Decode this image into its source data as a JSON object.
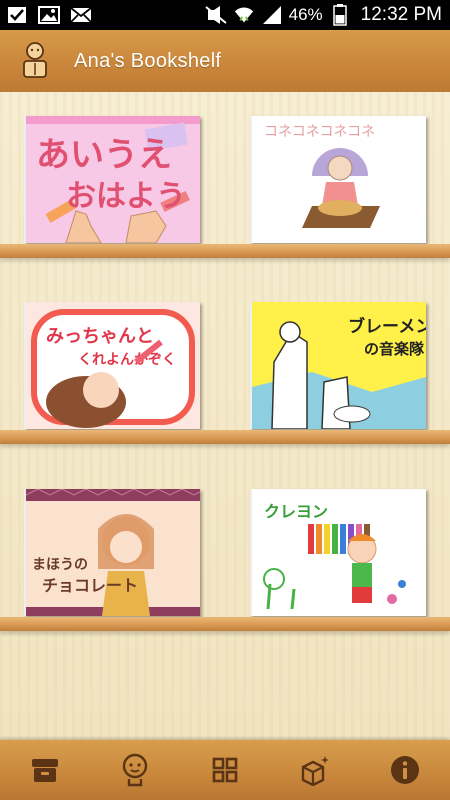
{
  "status_bar": {
    "battery_percent": "46%",
    "time": "12:32 PM",
    "icons": [
      "checkbox-icon",
      "image-icon",
      "mail-icon",
      "mute-icon",
      "wifi-icon",
      "signal-icon",
      "battery-icon"
    ]
  },
  "header": {
    "title": "Ana's Bookshelf",
    "logo_icon": "reading-character-icon"
  },
  "books": [
    {
      "title": "あいうえおはよう",
      "cover_color": "#f7c9e6"
    },
    {
      "title": "コネコネコネコネ",
      "cover_color": "#ffffff"
    },
    {
      "title": "みっちゃんとくれよんかぞく",
      "cover_color": "#fde7e0"
    },
    {
      "title": "ブレーメンの音楽隊",
      "cover_color": "#fff04a"
    },
    {
      "title": "まほうのチョコレート",
      "cover_color": "#fbe2cf"
    },
    {
      "title": "クレヨン",
      "cover_color": "#ffffff"
    }
  ],
  "bottom_nav": [
    {
      "icon": "archive-box-icon"
    },
    {
      "icon": "character-face-icon"
    },
    {
      "icon": "grid-icon"
    },
    {
      "icon": "cube-sparkle-icon"
    },
    {
      "icon": "info-icon"
    }
  ]
}
